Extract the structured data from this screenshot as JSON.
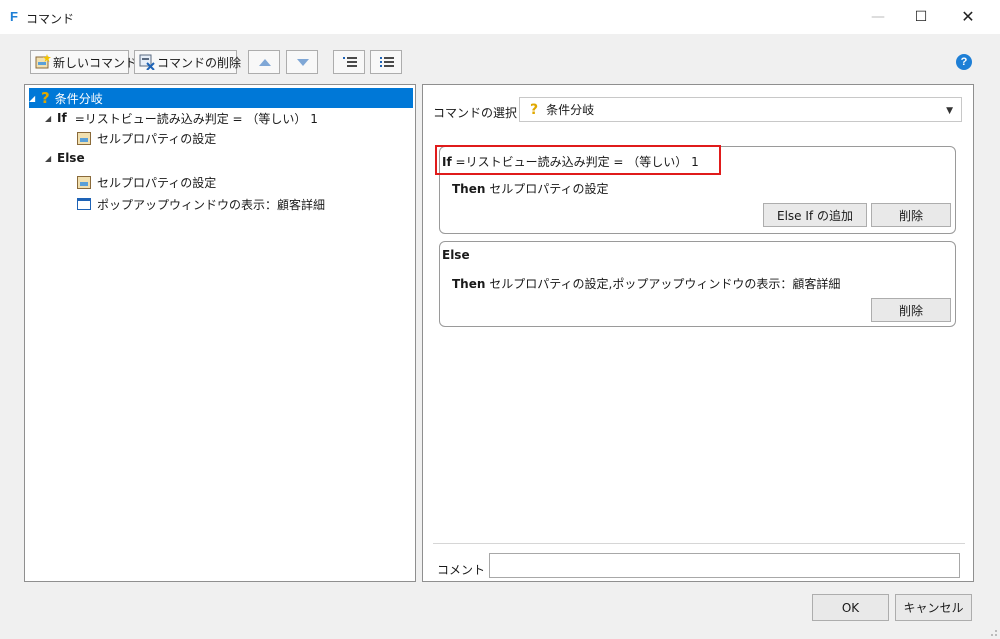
{
  "window": {
    "logo": "F",
    "title": "コマンド",
    "min_icon": "—",
    "max_icon": "☐",
    "close_icon": "✕"
  },
  "toolbar": {
    "new_label": "新しいコマンド",
    "delete_label": "コマンドの削除",
    "help_icon": "?"
  },
  "tree": {
    "root_label": "条件分岐",
    "if_keyword": "If",
    "if_condition": "=リストビュー読み込み判定 = （等しい） 1",
    "if_child": "セルプロパティの設定",
    "else_keyword": "Else",
    "else_child1": "セルプロパティの設定",
    "else_child2": "ポップアップウィンドウの表示：顧客詳細"
  },
  "editor": {
    "select_label": "コマンドの選択：",
    "select_value": "条件分岐",
    "if_head_kw": "If",
    "if_head_text": "=リストビュー読み込み判定 = （等しい） 1",
    "if_then_kw": "Then",
    "if_then_text": "セルプロパティの設定",
    "add_else_if": "Else If の追加",
    "delete1": "削除",
    "else_head": "Else",
    "else_then_kw": "Then",
    "else_then_text": "セルプロパティの設定,ポップアップウィンドウの表示：顧客詳細",
    "delete2": "削除",
    "comment_label": "コメント",
    "comment_value": ""
  },
  "footer": {
    "ok": "OK",
    "cancel": "キャンセル"
  },
  "colors": {
    "accent": "#0078d7",
    "highlight": "#e01b1b"
  }
}
